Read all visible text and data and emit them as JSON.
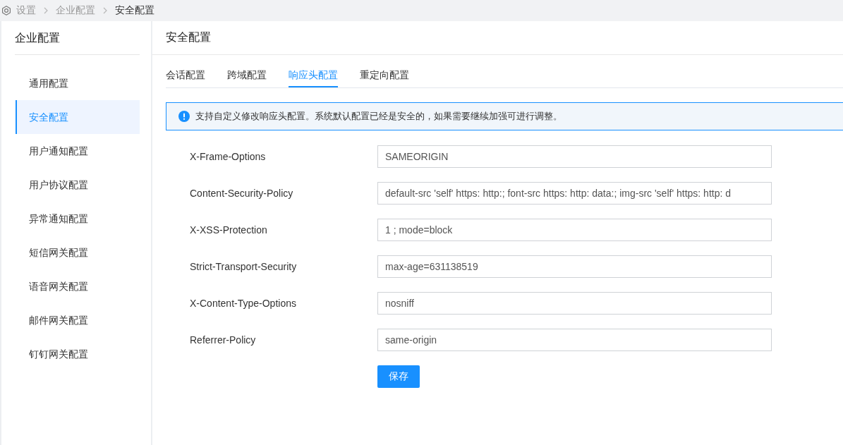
{
  "breadcrumb": [
    {
      "label": "设置",
      "current": false
    },
    {
      "label": "企业配置",
      "current": false
    },
    {
      "label": "安全配置",
      "current": true
    }
  ],
  "sidebar": {
    "title": "企业配置",
    "items": [
      {
        "label": "通用配置",
        "selected": false
      },
      {
        "label": "安全配置",
        "selected": true
      },
      {
        "label": "用户通知配置",
        "selected": false
      },
      {
        "label": "用户协议配置",
        "selected": false
      },
      {
        "label": "异常通知配置",
        "selected": false
      },
      {
        "label": "短信网关配置",
        "selected": false
      },
      {
        "label": "语音网关配置",
        "selected": false
      },
      {
        "label": "邮件网关配置",
        "selected": false
      },
      {
        "label": "钉钉网关配置",
        "selected": false
      }
    ]
  },
  "panel": {
    "title": "安全配置",
    "tabs": [
      {
        "label": "会话配置",
        "selected": false
      },
      {
        "label": "跨域配置",
        "selected": false
      },
      {
        "label": "响应头配置",
        "selected": true
      },
      {
        "label": "重定向配置",
        "selected": false
      }
    ],
    "alert": {
      "text": "支持自定义修改响应头配置。系统默认配置已经是安全的，如果需要继续加强可进行调整。"
    },
    "fields": [
      {
        "label": "X-Frame-Options",
        "value": "SAMEORIGIN"
      },
      {
        "label": "Content-Security-Policy",
        "value": "default-src 'self' https: http:; font-src https: http: data:; img-src 'self' https: http: d"
      },
      {
        "label": "X-XSS-Protection",
        "value": "1 ; mode=block"
      },
      {
        "label": "Strict-Transport-Security",
        "value": "max-age=631138519"
      },
      {
        "label": "X-Content-Type-Options",
        "value": "nosniff"
      },
      {
        "label": "Referrer-Policy",
        "value": "same-origin"
      }
    ],
    "save_button": "保存"
  }
}
